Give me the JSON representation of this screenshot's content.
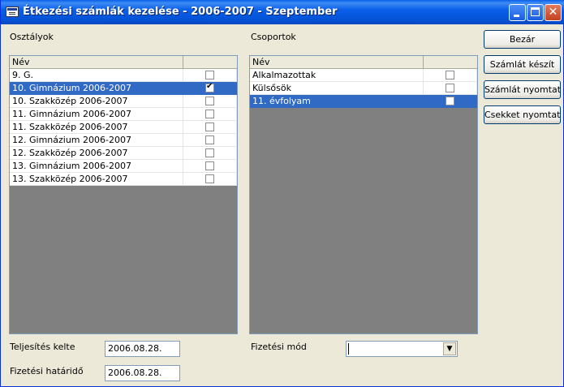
{
  "window": {
    "title": "Étkezési számlák kezelése - 2006-2007 - Szeptember"
  },
  "classes": {
    "label": "Osztályok",
    "column_name": "Név",
    "rows": [
      {
        "name": "9. G.",
        "checked": false,
        "selected": false
      },
      {
        "name": "10. Gimnázium 2006-2007",
        "checked": true,
        "selected": true
      },
      {
        "name": "10. Szakközép 2006-2007",
        "checked": false,
        "selected": false
      },
      {
        "name": "11. Gimnázium 2006-2007",
        "checked": false,
        "selected": false
      },
      {
        "name": "11. Szakközép 2006-2007",
        "checked": false,
        "selected": false
      },
      {
        "name": "12. Gimnázium 2006-2007",
        "checked": false,
        "selected": false
      },
      {
        "name": "12. Szakközép 2006-2007",
        "checked": false,
        "selected": false
      },
      {
        "name": "13. Gimnázium 2006-2007",
        "checked": false,
        "selected": false
      },
      {
        "name": "13. Szakközép 2006-2007",
        "checked": false,
        "selected": false
      }
    ]
  },
  "groups": {
    "label": "Csoportok",
    "column_name": "Név",
    "rows": [
      {
        "name": "Alkalmazottak",
        "checked": false,
        "selected": false
      },
      {
        "name": "Külsősök",
        "checked": false,
        "selected": false
      },
      {
        "name": "11. évfolyam",
        "checked": false,
        "selected": true
      }
    ]
  },
  "buttons": {
    "close": "Bezár",
    "create_invoice": "Számlát készít",
    "print_invoice": "Számlát nyomtat",
    "print_checks": "Csekket nyomtat"
  },
  "form": {
    "completion_date_label": "Teljesítés kelte",
    "completion_date": "2006.08.28.",
    "payment_deadline_label": "Fizetési határidő",
    "payment_deadline": "2006.08.28.",
    "payment_method_label": "Fizetési mód",
    "payment_method": ""
  }
}
